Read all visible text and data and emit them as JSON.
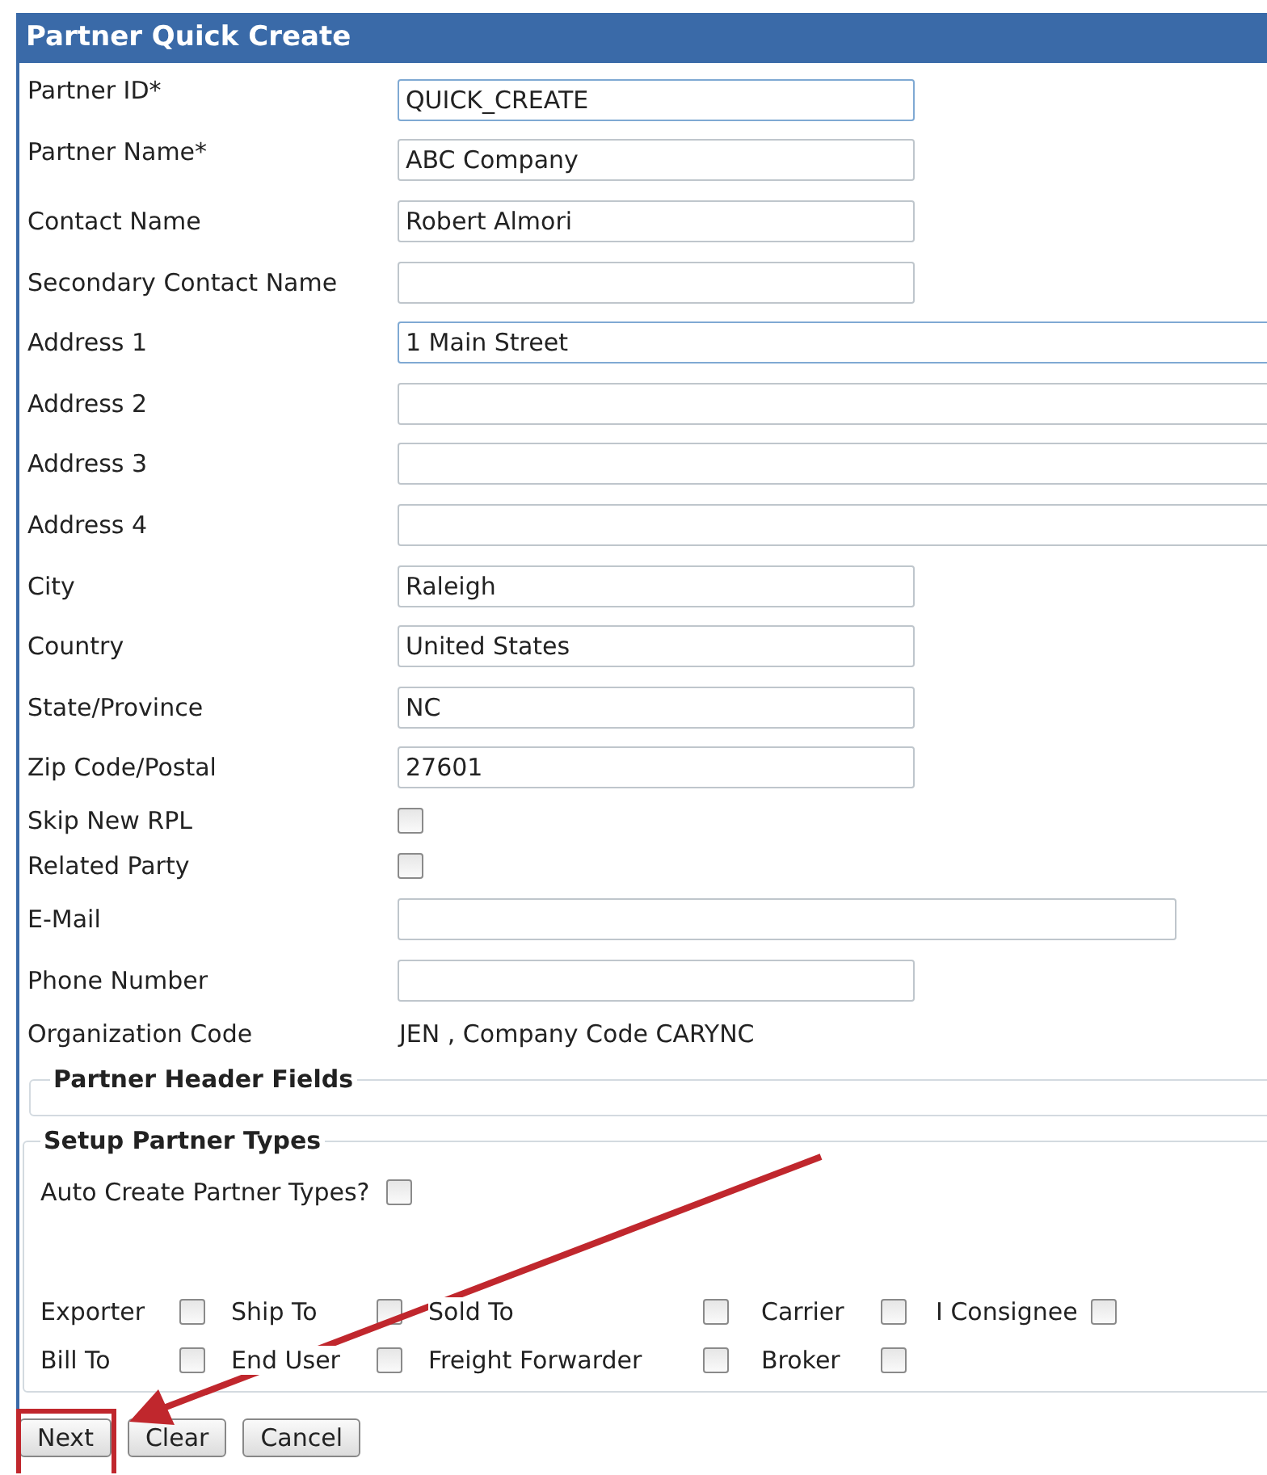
{
  "window": {
    "title": "Partner Quick Create"
  },
  "fields": [
    {
      "kind": "short",
      "label": "Partner ID*",
      "value": "QUICK_CREATE",
      "focused": true
    },
    {
      "kind": "short",
      "label": "Partner Name*",
      "value": "ABC Company",
      "focused": false
    },
    {
      "kind": "short",
      "label": "Contact Name",
      "value": "Robert Almori",
      "focused": false
    },
    {
      "kind": "short",
      "label": "Secondary Contact Name",
      "focused": false
    },
    {
      "kind": "long",
      "label": "Address 1",
      "value": "1 Main Street",
      "focused": true
    },
    {
      "kind": "long",
      "label": "Address 2",
      "focused": false
    },
    {
      "kind": "long",
      "label": "Address 3",
      "focused": false
    },
    {
      "kind": "long",
      "label": "Address 4",
      "focused": false
    },
    {
      "kind": "short",
      "label": "City",
      "value": "Raleigh",
      "focused": false
    },
    {
      "kind": "short",
      "label": "Country",
      "value": "United States",
      "focused": false
    },
    {
      "kind": "short",
      "label": "State/Province",
      "value": "NC",
      "focused": false
    },
    {
      "kind": "short",
      "label": "Zip Code/Postal",
      "value": "27601",
      "focused": false
    },
    {
      "kind": "checkbox",
      "label": "Skip New RPL",
      "checked": false
    },
    {
      "kind": "checkbox",
      "label": "Related Party",
      "checked": false
    },
    {
      "kind": "medium",
      "label": "E-Mail",
      "focused": false
    },
    {
      "kind": "short",
      "label": "Phone Number",
      "focused": false
    },
    {
      "kind": "static",
      "label": "Organization Code",
      "value": "JEN , Company Code CARYNC"
    }
  ],
  "header_fields": {
    "title": "Partner Header Fields"
  },
  "partner_types": {
    "title": "Setup Partner Types",
    "auto_create": {
      "label": "Auto Create Partner Types?",
      "checked": false
    },
    "rows": [
      [
        {
          "label": "Exporter",
          "checked": false
        },
        {
          "label": "Ship To",
          "checked": false
        },
        {
          "label": "Sold To",
          "checked": false
        },
        {
          "label": "Carrier",
          "checked": false
        },
        {
          "label": "I Consignee",
          "checked": false
        }
      ],
      [
        {
          "label": "Bill To",
          "checked": false
        },
        {
          "label": "End User",
          "checked": false
        },
        {
          "label": "Freight Forwarder",
          "checked": false
        },
        {
          "label": "Broker",
          "checked": false
        }
      ]
    ]
  },
  "buttons": [
    "Next",
    "Clear",
    "Cancel"
  ]
}
